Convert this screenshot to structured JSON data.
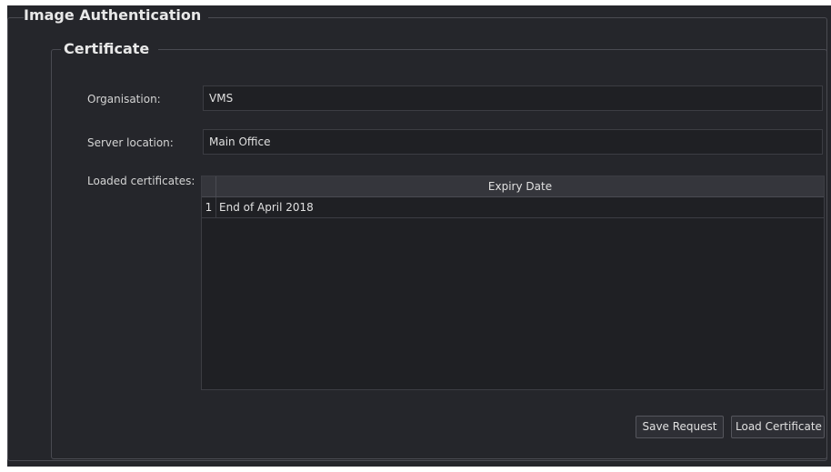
{
  "groups": {
    "outer_title": "Image Authentication",
    "inner_title": "Certificate"
  },
  "form": {
    "organisation_label": "Organisation:",
    "organisation_value": "VMS",
    "server_location_label": "Server location:",
    "server_location_value": "Main Office",
    "loaded_certificates_label": "Loaded certificates:"
  },
  "certificates_table": {
    "columns": [
      "Expiry Date"
    ],
    "rows": [
      {
        "index": "1",
        "expiry_date": "End of April 2018"
      }
    ]
  },
  "buttons": {
    "save_request": "Save Request",
    "load_certificate": "Load Certificate"
  },
  "colors": {
    "panel_background": "#25262b",
    "field_background": "#1f2024",
    "header_background": "#35363c"
  }
}
